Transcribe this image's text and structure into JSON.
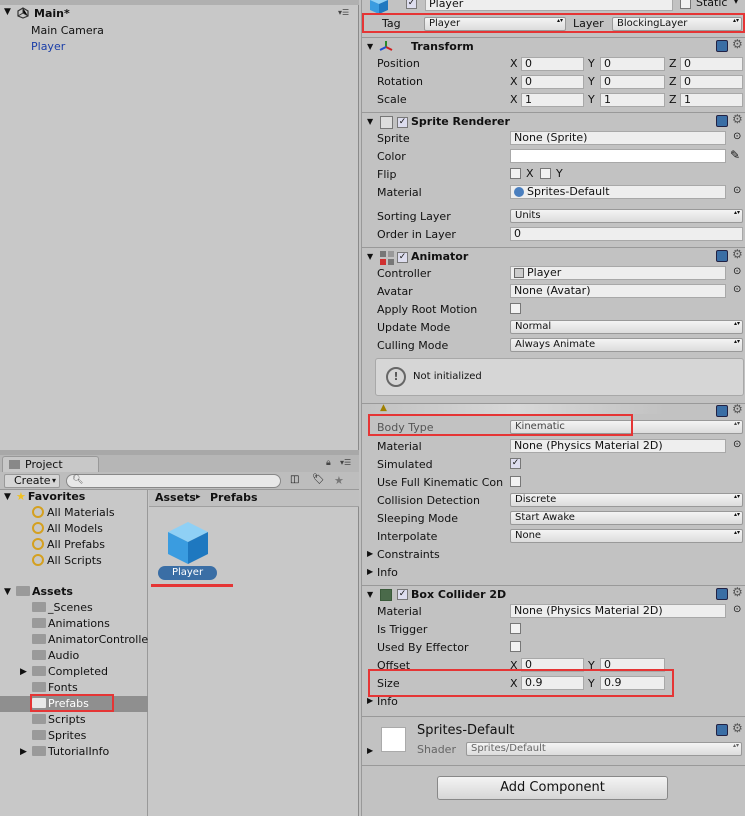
{
  "hierarchy": {
    "scene_name": "Main*",
    "items": [
      "Main Camera",
      "Player"
    ]
  },
  "project": {
    "tab_label": "Project",
    "create_label": "Create",
    "favorites_label": "Favorites",
    "favorites": [
      "All Materials",
      "All Models",
      "All Prefabs",
      "All Scripts"
    ],
    "assets_label": "Assets",
    "asset_folders": [
      "_Scenes",
      "Animations",
      "AnimatorControlle",
      "Audio",
      "Completed",
      "Fonts",
      "Prefabs",
      "Scripts",
      "Sprites",
      "TutorialInfo"
    ],
    "breadcrumb": [
      "Assets",
      "Prefabs"
    ],
    "breadcrumb_sep": "▸",
    "prefab_item": "Player"
  },
  "inspector": {
    "object_name": "Player",
    "static_label": "Static",
    "tag_label": "Tag",
    "tag_value": "Player",
    "layer_label": "Layer",
    "layer_value": "BlockingLayer",
    "transform": {
      "title": "Transform",
      "position_label": "Position",
      "rotation_label": "Rotation",
      "scale_label": "Scale",
      "x": "X",
      "y": "Y",
      "z": "Z",
      "position": [
        "0",
        "0",
        "0"
      ],
      "rotation": [
        "0",
        "0",
        "0"
      ],
      "scale": [
        "1",
        "1",
        "1"
      ]
    },
    "sprite_renderer": {
      "title": "Sprite Renderer",
      "sprite_label": "Sprite",
      "sprite_value": "None (Sprite)",
      "color_label": "Color",
      "flip_label": "Flip",
      "flip_x": "X",
      "flip_y": "Y",
      "material_label": "Material",
      "material_value": "Sprites-Default",
      "sorting_layer_label": "Sorting Layer",
      "sorting_layer_value": "Units",
      "order_label": "Order in Layer",
      "order_value": "0"
    },
    "animator": {
      "title": "Animator",
      "controller_label": "Controller",
      "controller_value": "Player",
      "avatar_label": "Avatar",
      "avatar_value": "None (Avatar)",
      "root_motion_label": "Apply Root Motion",
      "update_mode_label": "Update Mode",
      "update_mode_value": "Normal",
      "culling_mode_label": "Culling Mode",
      "culling_mode_value": "Always Animate",
      "not_initialized": "Not initialized"
    },
    "rigidbody": {
      "body_type_label": "Body Type",
      "body_type_value": "Kinematic",
      "material_label": "Material",
      "material_value": "None (Physics Material 2D)",
      "simulated_label": "Simulated",
      "full_kinematic_label": "Use Full Kinematic Con",
      "collision_label": "Collision Detection",
      "collision_value": "Discrete",
      "sleeping_label": "Sleeping Mode",
      "sleeping_value": "Start Awake",
      "interpolate_label": "Interpolate",
      "interpolate_value": "None",
      "constraints_label": "Constraints",
      "info_label": "Info"
    },
    "box_collider": {
      "title": "Box Collider 2D",
      "material_label": "Material",
      "material_value": "None (Physics Material 2D)",
      "is_trigger_label": "Is Trigger",
      "used_by_effector_label": "Used By Effector",
      "offset_label": "Offset",
      "offset": [
        "0",
        "0"
      ],
      "size_label": "Size",
      "size": [
        "0.9",
        "0.9"
      ],
      "x": "X",
      "y": "Y",
      "info_label": "Info"
    },
    "material_preview": {
      "name": "Sprites-Default",
      "shader_label": "Shader",
      "shader_value": "Sprites/Default"
    },
    "add_component_label": "Add Component"
  },
  "colors": {
    "highlight_red": "#e53535",
    "selected_blue": "#3a6ea5",
    "player_link": "#1a3ea8"
  }
}
